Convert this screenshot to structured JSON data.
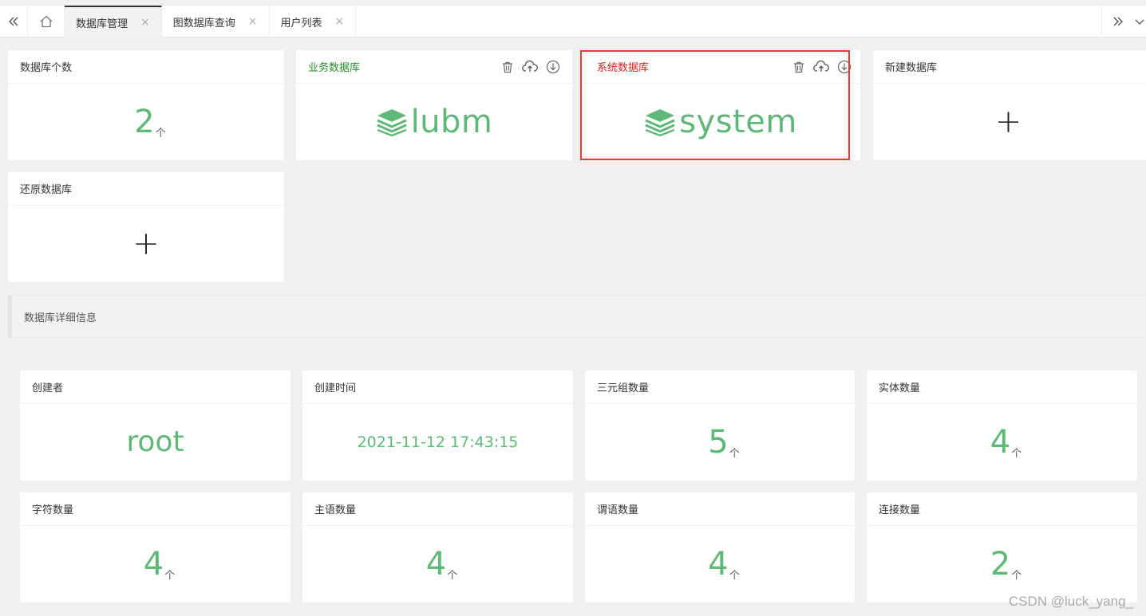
{
  "tabs": [
    {
      "label": "数据库管理",
      "active": true
    },
    {
      "label": "图数据库查询",
      "active": false
    },
    {
      "label": "用户列表",
      "active": false
    }
  ],
  "tab_close_glyph": "×",
  "overview": {
    "db_count_title": "数据库个数",
    "db_count_value": "2",
    "unit": "个",
    "databases": [
      {
        "title": "业务数据库",
        "name": "lubm",
        "title_color": "#2a8a2a"
      },
      {
        "title": "系统数据库",
        "name": "system",
        "title_color": "#e02020"
      }
    ],
    "new_db_title": "新建数据库",
    "restore_db_title": "还原数据库",
    "plus_glyph": "+"
  },
  "section": {
    "title": "数据库详细信息"
  },
  "details": [
    {
      "label": "创建者",
      "value": "root",
      "unit": ""
    },
    {
      "label": "创建时间",
      "value": "2021-11-12 17:43:15",
      "unit": ""
    },
    {
      "label": "三元组数量",
      "value": "5",
      "unit": "个"
    },
    {
      "label": "实体数量",
      "value": "4",
      "unit": "个"
    },
    {
      "label": "字符数量",
      "value": "4",
      "unit": "个"
    },
    {
      "label": "主语数量",
      "value": "4",
      "unit": "个"
    },
    {
      "label": "谓语数量",
      "value": "4",
      "unit": "个"
    },
    {
      "label": "连接数量",
      "value": "2",
      "unit": "个"
    }
  ],
  "watermark": "CSDN @luck_yang_",
  "colors": {
    "accent": "#5fb878",
    "highlight_border": "#e53935"
  },
  "icons": [
    "double-left-icon",
    "home-icon",
    "close-icon",
    "double-right-icon",
    "chevron-down-icon",
    "trash-icon",
    "cloud-upload-icon",
    "download-icon",
    "database-stack-icon"
  ]
}
